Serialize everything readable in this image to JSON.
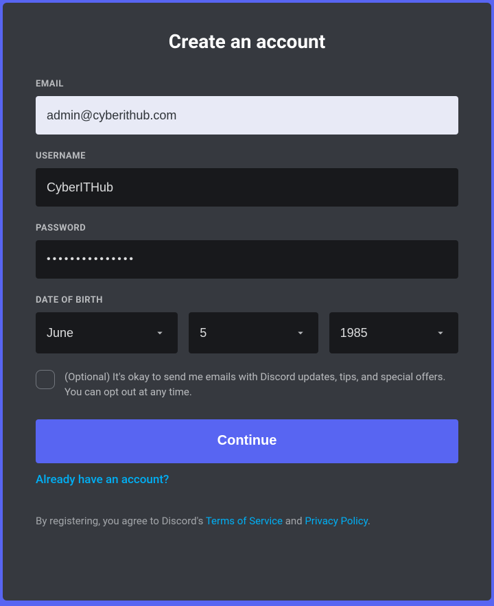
{
  "title": "Create an account",
  "fields": {
    "email": {
      "label": "EMAIL",
      "value": "admin@cyberithub.com"
    },
    "username": {
      "label": "USERNAME",
      "value": "CyberITHub"
    },
    "password": {
      "label": "PASSWORD",
      "value": "•••••••••••••••"
    },
    "dob": {
      "label": "DATE OF BIRTH",
      "month": "June",
      "day": "5",
      "year": "1985"
    }
  },
  "optin": {
    "text": "(Optional) It's okay to send me emails with Discord updates, tips, and special offers. You can opt out at any time."
  },
  "continue_label": "Continue",
  "login_link": "Already have an account?",
  "legal": {
    "prefix": "By registering, you agree to Discord's ",
    "tos": "Terms of Service",
    "mid": " and ",
    "privacy": "Privacy Policy",
    "suffix": "."
  }
}
